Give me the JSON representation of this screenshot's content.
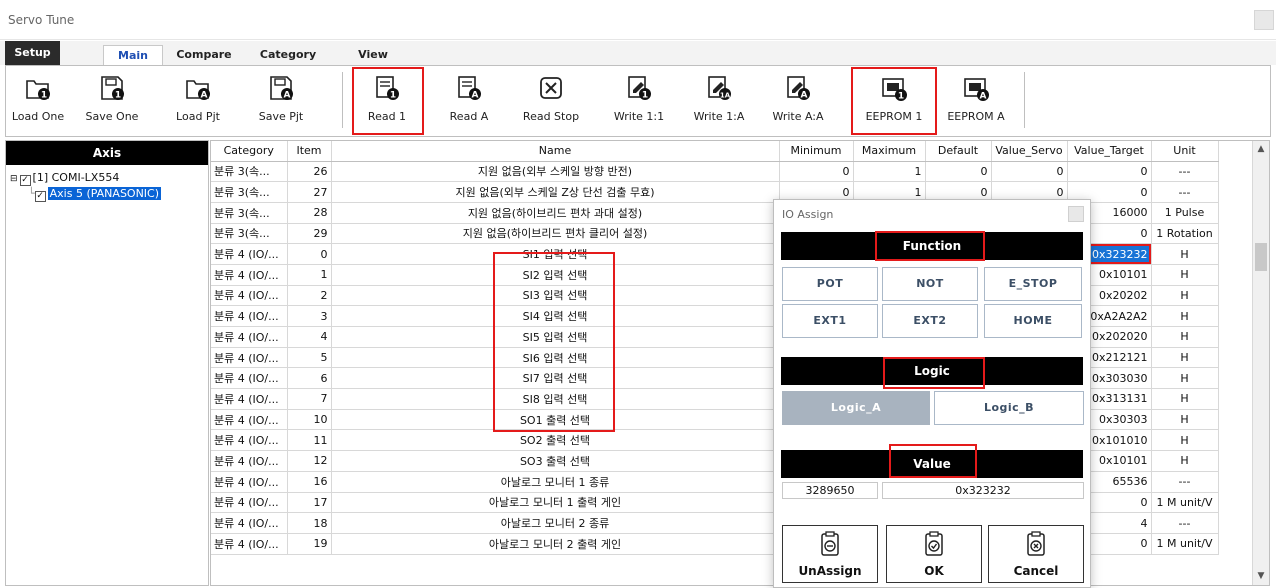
{
  "window": {
    "title": "Servo Tune"
  },
  "tabs": [
    "Setup",
    "Main",
    "Compare",
    "Category",
    "View"
  ],
  "toolbar": {
    "buttons": [
      "Load One",
      "Save One",
      "Load Pjt",
      "Save Pjt",
      "Read 1",
      "Read A",
      "Read Stop",
      "Write 1:1",
      "Write 1:A",
      "Write A:A",
      "EEPROM 1",
      "EEPROM A"
    ],
    "icons": [
      "folder-1-icon",
      "save-1-icon",
      "folder-a-icon",
      "save-a-icon",
      "read-1-icon",
      "read-a-icon",
      "read-stop-icon",
      "write-1-1-icon",
      "write-1-a-icon",
      "write-a-a-icon",
      "eeprom-1-icon",
      "eeprom-a-icon"
    ],
    "highlight_color": "#e41a1a"
  },
  "axis_panel": {
    "header": "Axis",
    "controller": "[1] COMI-LX554",
    "axis": "Axis 5 (PANASONIC)",
    "selection_color": "#0a64d6"
  },
  "grid": {
    "columns": [
      "Category",
      "Item",
      "Name",
      "Minimum",
      "Maximum",
      "Default",
      "Value_Servo",
      "Value_Target",
      "Unit"
    ],
    "rows": [
      [
        "분류 3(속...",
        "26",
        "지원 없음(외부 스케일 방향 반전)",
        "0",
        "1",
        "0",
        "0",
        "0",
        "---"
      ],
      [
        "분류 3(속...",
        "27",
        "지원 없음(외부 스케일 Z상 단선 검출 무효)",
        "0",
        "1",
        "0",
        "0",
        "0",
        "---"
      ],
      [
        "분류 3(속...",
        "28",
        "지원 없음(하이브리드 편차 과대 설정)",
        "",
        "",
        "",
        "",
        "16000",
        "1 Pulse"
      ],
      [
        "분류 3(속...",
        "29",
        "지원 없음(하이브리드 편차 클리어 설정)",
        "",
        "",
        "",
        "",
        "0",
        "1 Rotation"
      ],
      [
        "분류 4 (IO/...",
        "0",
        "SI1 입력 선택",
        "",
        "",
        "",
        "",
        "0x323232",
        "H"
      ],
      [
        "분류 4 (IO/...",
        "1",
        "SI2 입력 선택",
        "",
        "",
        "",
        "",
        "0x10101",
        "H"
      ],
      [
        "분류 4 (IO/...",
        "2",
        "SI3 입력 선택",
        "",
        "",
        "",
        "",
        "0x20202",
        "H"
      ],
      [
        "분류 4 (IO/...",
        "3",
        "SI4 입력 선택",
        "",
        "",
        "",
        "",
        "0xA2A2A2",
        "H"
      ],
      [
        "분류 4 (IO/...",
        "4",
        "SI5 입력 선택",
        "",
        "",
        "",
        "",
        "0x202020",
        "H"
      ],
      [
        "분류 4 (IO/...",
        "5",
        "SI6 입력 선택",
        "",
        "",
        "",
        "",
        "0x212121",
        "H"
      ],
      [
        "분류 4 (IO/...",
        "6",
        "SI7 입력 선택",
        "",
        "",
        "",
        "",
        "0x303030",
        "H"
      ],
      [
        "분류 4 (IO/...",
        "7",
        "SI8 입력 선택",
        "",
        "",
        "",
        "",
        "0x313131",
        "H"
      ],
      [
        "분류 4 (IO/...",
        "10",
        "SO1 출력 선택",
        "",
        "",
        "",
        "",
        "0x30303",
        "H"
      ],
      [
        "분류 4 (IO/...",
        "11",
        "SO2 출력 선택",
        "",
        "",
        "",
        "",
        "0x101010",
        "H"
      ],
      [
        "분류 4 (IO/...",
        "12",
        "SO3 출력 선택",
        "",
        "",
        "",
        "",
        "0x10101",
        "H"
      ],
      [
        "분류 4 (IO/...",
        "16",
        "아날로그 모니터 1 종류",
        "",
        "",
        "",
        "",
        "65536",
        "---"
      ],
      [
        "분류 4 (IO/...",
        "17",
        "아날로그 모니터 1 출력 게인",
        "",
        "",
        "",
        "",
        "0",
        "1 M unit/V"
      ],
      [
        "분류 4 (IO/...",
        "18",
        "아날로그 모니터 2 종류",
        "",
        "",
        "",
        "",
        "4",
        "---"
      ],
      [
        "분류 4 (IO/...",
        "19",
        "아날로그 모니터 2 출력 게인",
        "",
        "",
        "",
        "",
        "0",
        "1 M unit/V"
      ]
    ],
    "selected_row": 4,
    "selected_color": "#1873d6"
  },
  "dialog": {
    "title": "IO Assign",
    "function_header": "Function",
    "function_buttons": [
      "POT",
      "NOT",
      "E_STOP",
      "EXT1",
      "EXT2",
      "HOME"
    ],
    "logic_header": "Logic",
    "logic_buttons": [
      "Logic_A",
      "Logic_B"
    ],
    "logic_selected": "Logic_A",
    "value_header": "Value",
    "value_decimal": "3289650",
    "value_hex": "0x323232",
    "actions": [
      "UnAssign",
      "OK",
      "Cancel"
    ],
    "action_icons": [
      "unassign-icon",
      "ok-icon",
      "cancel-icon"
    ]
  }
}
